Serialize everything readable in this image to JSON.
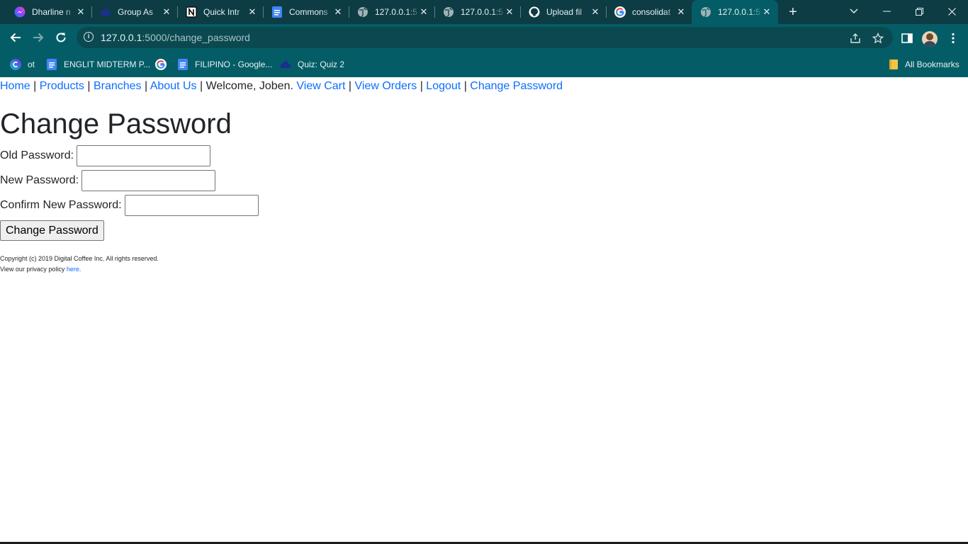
{
  "browser": {
    "tabs": [
      {
        "title": "Dharline n",
        "icon": "messenger-icon"
      },
      {
        "title": "Group As",
        "icon": "cloud-icon"
      },
      {
        "title": "Quick Intr",
        "icon": "notion-icon"
      },
      {
        "title": "Commons",
        "icon": "google-docs-icon"
      },
      {
        "title": "127.0.0.1:5",
        "icon": "globe-icon"
      },
      {
        "title": "127.0.0.1:5",
        "icon": "globe-icon"
      },
      {
        "title": "Upload fil",
        "icon": "github-icon"
      },
      {
        "title": "consolidat",
        "icon": "google-icon"
      },
      {
        "title": "127.0.0.1:5",
        "icon": "globe-icon",
        "active": true
      }
    ],
    "url_host": "127.0.0.1",
    "url_rest": ":5000/change_password",
    "bookmarks": [
      {
        "label": "ot",
        "icon": "canva-icon"
      },
      {
        "label": "ENGLIT MIDTERM P...",
        "icon": "google-docs-icon"
      },
      {
        "label": "",
        "icon": "google-icon"
      },
      {
        "label": "FILIPINO - Google...",
        "icon": "google-docs-icon"
      },
      {
        "label": "Quiz: Quiz 2",
        "icon": "cloud-icon"
      }
    ],
    "all_bookmarks_label": "All Bookmarks",
    "colors": {
      "frame": "#0d3c45",
      "toolbar": "#045d66",
      "link": "#0d6efd"
    }
  },
  "nav": {
    "home": "Home",
    "products": "Products",
    "branches": "Branches",
    "about": "About Us",
    "welcome": "Welcome, Joben.",
    "view_cart": "View Cart",
    "view_orders": "View Orders",
    "logout": "Logout",
    "change_password": "Change Password",
    "separator": "|"
  },
  "form": {
    "title": "Change Password",
    "old_label": "Old Password:",
    "new_label": "New Password:",
    "confirm_label": "Confirm New Password:",
    "old_value": "",
    "new_value": "",
    "confirm_value": "",
    "submit_label": "Change Password"
  },
  "footer": {
    "copyright": "Copyright (c) 2019 Digital Coffee Inc. All rights reserved.",
    "privacy_text": "View our privacy policy",
    "privacy_link": "here."
  }
}
